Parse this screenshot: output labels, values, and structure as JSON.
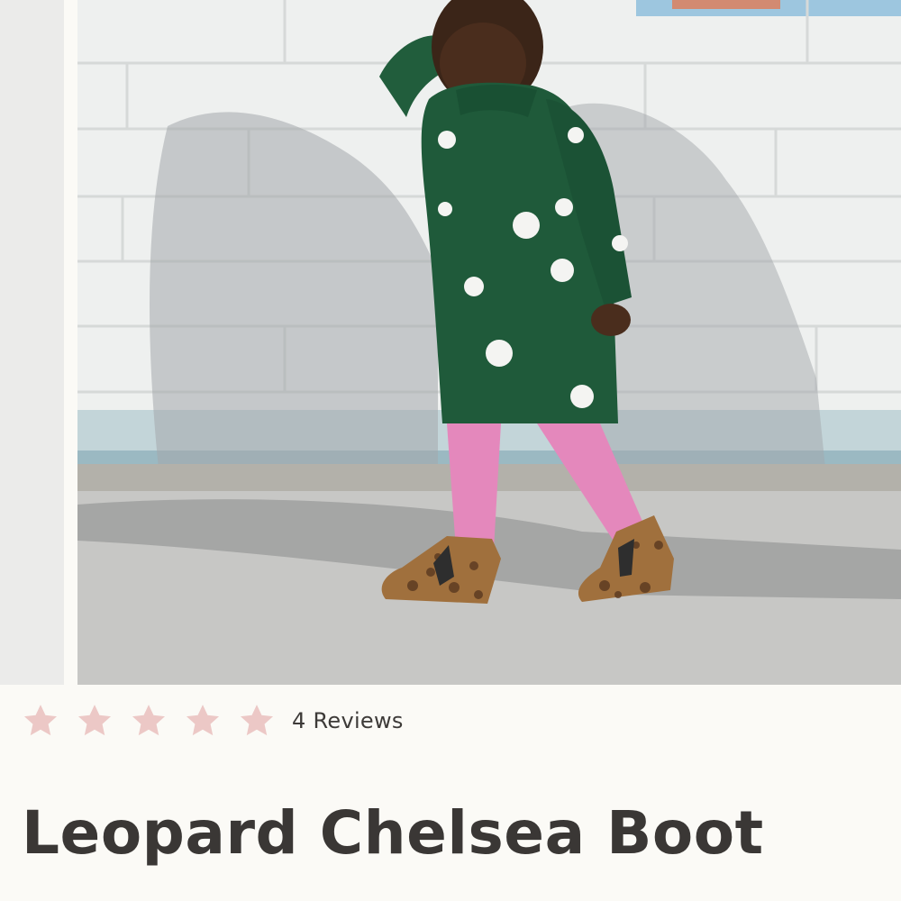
{
  "product": {
    "title": "Leopard Chelsea Boot",
    "image_alt": "Toddler in green polka dot dress with pink tights wearing leopard chelsea boots",
    "rating": {
      "stars_filled": 5,
      "stars_total": 5,
      "reviews_label": "4 Reviews"
    }
  },
  "colors": {
    "star": "#ecc8c6",
    "title": "#3a3735",
    "background": "#fbfaf6",
    "dress": "#1f5a3a",
    "tights": "#e488bc",
    "wall": "#eef0ef"
  },
  "icons": {
    "star": "star-icon"
  }
}
